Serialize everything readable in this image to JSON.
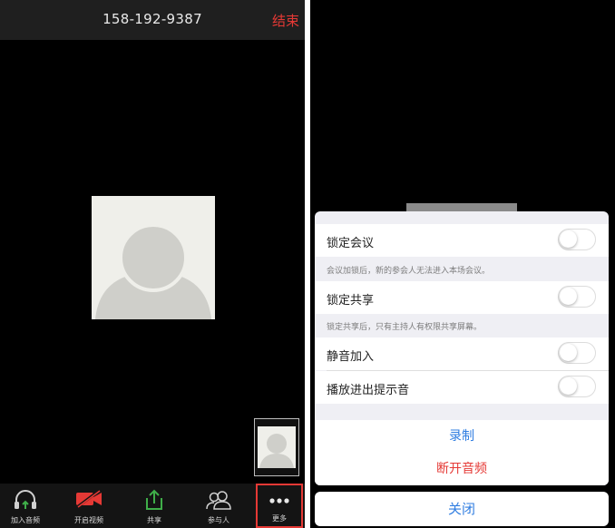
{
  "call": {
    "phone_number": "158-192-9387",
    "end_label": "结束"
  },
  "toolbar": {
    "items": [
      {
        "label": "加入音频",
        "icon": "headphones-icon"
      },
      {
        "label": "开启视频",
        "icon": "video-off-icon"
      },
      {
        "label": "共享",
        "icon": "share-icon"
      },
      {
        "label": "参与人",
        "icon": "participants-icon"
      },
      {
        "label": "更多",
        "icon": "more-icon"
      }
    ]
  },
  "more_menu": {
    "lock_meeting": {
      "label": "锁定会议",
      "on": false,
      "hint": "会议加锁后，新的参会人无法进入本场会议。"
    },
    "lock_share": {
      "label": "锁定共享",
      "on": false,
      "hint": "锁定共享后，只有主持人有权限共享屏幕。"
    },
    "mute_on_entry": {
      "label": "静音加入",
      "on": false
    },
    "chime": {
      "label": "播放进出提示音",
      "on": false
    },
    "record_label": "录制",
    "disconnect_audio_label": "断开音频",
    "close_label": "关闭"
  },
  "colors": {
    "accent_blue": "#2f7de1",
    "danger_red": "#e53935",
    "share_green": "#3fae49"
  }
}
